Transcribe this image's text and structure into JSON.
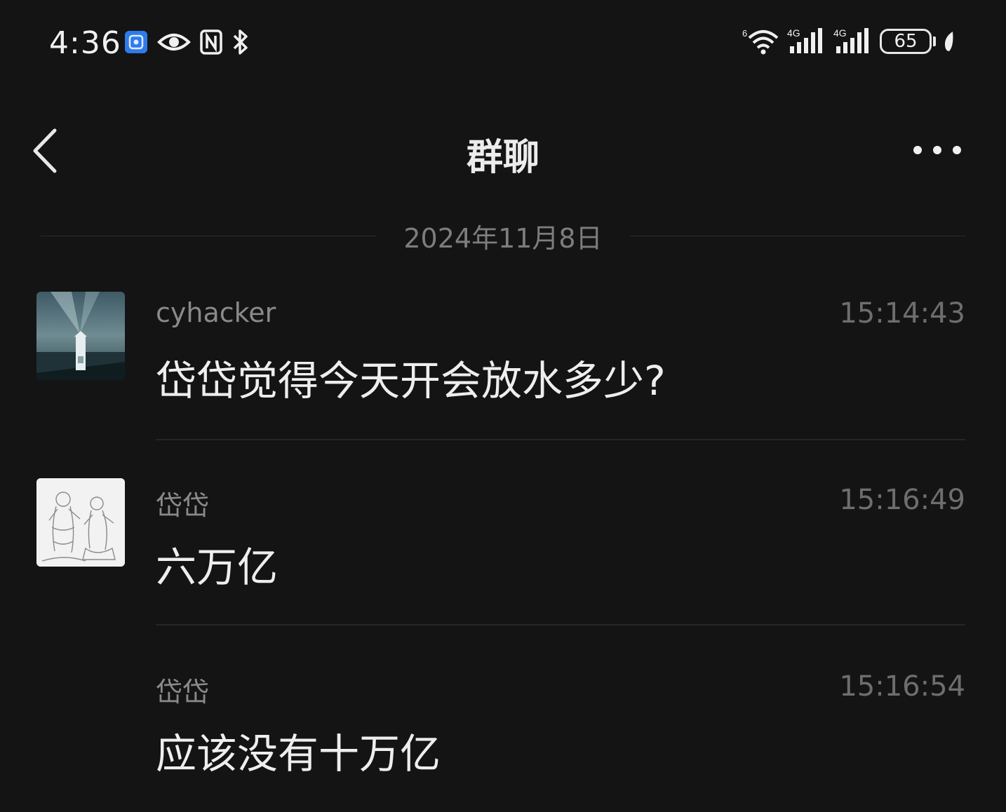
{
  "status_bar": {
    "time": "4:36",
    "left_icons": [
      "app-notification-icon",
      "eye-icon",
      "nfc-icon",
      "bluetooth-icon"
    ],
    "right_icons": [
      "wifi-icon",
      "signal-4g-icon",
      "signal-4g-icon"
    ],
    "wifi_label": "6",
    "signal_labels": [
      "4G",
      "4G"
    ],
    "battery_level": "65"
  },
  "nav": {
    "title": "群聊"
  },
  "date_divider": "2024年11月8日",
  "messages": [
    {
      "sender": "cyhacker",
      "time": "15:14:43",
      "text": "岱岱觉得今天开会放水多少?",
      "avatar": "lighthouse-photo"
    },
    {
      "sender": "岱岱",
      "time": "15:16:49",
      "text": "六万亿",
      "avatar": "sketch-drawing"
    },
    {
      "sender": "岱岱",
      "time": "15:16:54",
      "text": "应该没有十万亿",
      "avatar": ""
    }
  ],
  "colors": {
    "background": "#141414",
    "primary_text": "#eeeeee",
    "secondary_text": "#8a8a8a",
    "timestamp": "#6e6e6e",
    "separator": "#262626"
  }
}
